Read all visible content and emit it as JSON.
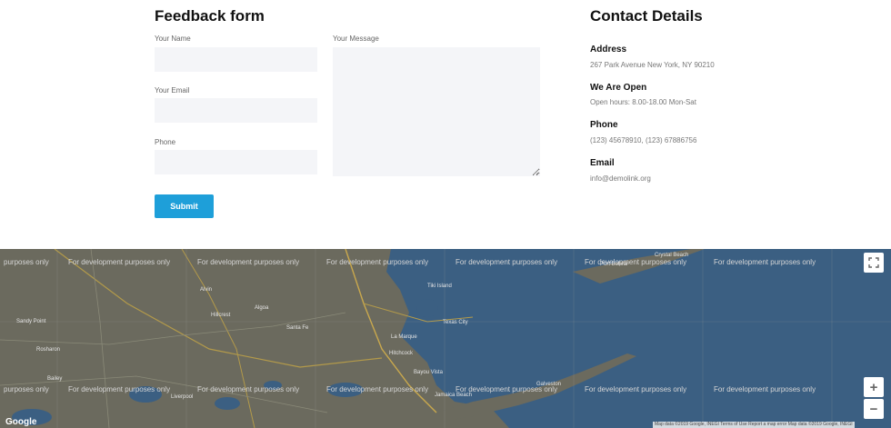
{
  "form": {
    "title": "Feedback form",
    "name_label": "Your Name",
    "email_label": "Your Email",
    "phone_label": "Phone",
    "message_label": "Your Message",
    "submit_label": "Submit"
  },
  "contact": {
    "title": "Contact Details",
    "address_heading": "Address",
    "address_value": "267 Park Avenue New York, NY 90210",
    "open_heading": "We Are Open",
    "open_value": "Open hours: 8.00-18.00 Mon-Sat",
    "phone_heading": "Phone",
    "phone_value": "(123) 45678910, (123) 67886756",
    "email_heading": "Email",
    "email_value": "info@demolink.org"
  },
  "map": {
    "dev_text": "For development purposes only",
    "dev_text_left_cut": "purposes only",
    "google_label": "Google",
    "attribution": "Map data ©2019 Google, INEGI   Terms of Use   Report a map error  Map data ©2019 Google, INEGI",
    "zoom_in": "+",
    "zoom_out": "−",
    "places": [
      "Alvin",
      "Algoa",
      "Hillcrest",
      "Santa Fe",
      "Sandy Point",
      "Rosharon",
      "Bailey",
      "Liverpool",
      "La Marque",
      "Texas City",
      "Hitchcock",
      "Bayou Vista",
      "Jamaica Beach",
      "Galveston",
      "Tiki Island",
      "Crystal Beach",
      "Port Bolivar"
    ],
    "land_color": "#6b6a5e",
    "water_color": "#3b5f82"
  },
  "colors": {
    "accent": "#1e9fd9",
    "input_bg": "#f4f5f8"
  }
}
